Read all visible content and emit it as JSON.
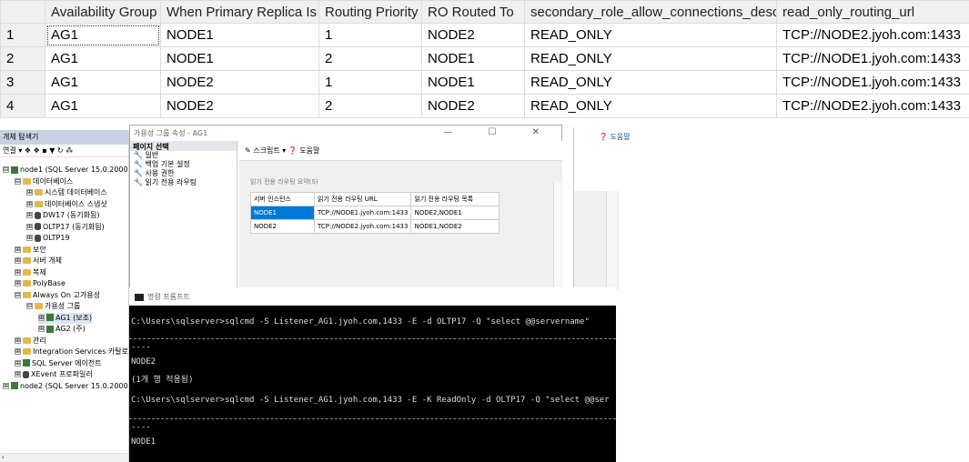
{
  "results": {
    "columns": [
      "",
      "Availability Group",
      "When Primary Replica Is",
      "Routing Priority",
      "RO Routed To",
      "secondary_role_allow_connections_desc",
      "read_only_routing_url"
    ],
    "rows": [
      [
        "1",
        "AG1",
        "NODE1",
        "1",
        "NODE2",
        "READ_ONLY",
        "TCP://NODE2.jyoh.com:1433"
      ],
      [
        "2",
        "AG1",
        "NODE1",
        "2",
        "NODE1",
        "READ_ONLY",
        "TCP://NODE1.jyoh.com:1433"
      ],
      [
        "3",
        "AG1",
        "NODE2",
        "1",
        "NODE1",
        "READ_ONLY",
        "TCP://NODE1.jyoh.com:1433"
      ],
      [
        "4",
        "AG1",
        "NODE2",
        "2",
        "NODE2",
        "READ_ONLY",
        "TCP://NODE2.jyoh.com:1433"
      ]
    ]
  },
  "object_explorer": {
    "title": "개체 탐색기",
    "toolbar": "연결 ▾ ❖ ❖ ▪ ▼ ↻ ⁂",
    "nodes": [
      {
        "label": "node1 (SQL Server 15.0.2000.",
        "level": 0,
        "expand": "⊟",
        "icon": "server-icon"
      },
      {
        "label": "데이터베이스",
        "level": 1,
        "expand": "⊟",
        "icon": "folder-icon"
      },
      {
        "label": "시스템 데이터베이스",
        "level": 2,
        "expand": "⊞",
        "icon": "folder-icon"
      },
      {
        "label": "데이터베이스 스냅샷",
        "level": 2,
        "expand": "⊞",
        "icon": "folder-icon"
      },
      {
        "label": "DW17 (동기화됨)",
        "level": 2,
        "expand": "⊞",
        "icon": "database-icon"
      },
      {
        "label": "OLTP17 (동기화됨)",
        "level": 2,
        "expand": "⊞",
        "icon": "database-icon"
      },
      {
        "label": "OLTP19",
        "level": 2,
        "expand": "⊞",
        "icon": "database-icon"
      },
      {
        "label": "보안",
        "level": 1,
        "expand": "⊞",
        "icon": "folder-icon"
      },
      {
        "label": "서버 개체",
        "level": 1,
        "expand": "⊞",
        "icon": "folder-icon"
      },
      {
        "label": "복제",
        "level": 1,
        "expand": "⊞",
        "icon": "folder-icon"
      },
      {
        "label": "PolyBase",
        "level": 1,
        "expand": "⊞",
        "icon": "folder-icon"
      },
      {
        "label": "Always On 고가용성",
        "level": 1,
        "expand": "⊟",
        "icon": "folder-icon"
      },
      {
        "label": "가용성 그룹",
        "level": 2,
        "expand": "⊟",
        "icon": "folder-icon"
      },
      {
        "label": "AG1 (보조)",
        "level": 3,
        "expand": "⊞",
        "icon": "availability-group-icon",
        "selected": true
      },
      {
        "label": "AG2 (주)",
        "level": 3,
        "expand": "⊞",
        "icon": "availability-group-icon"
      },
      {
        "label": "관리",
        "level": 1,
        "expand": "⊞",
        "icon": "folder-icon"
      },
      {
        "label": "Integration Services 카탈로",
        "level": 1,
        "expand": "⊞",
        "icon": "folder-icon"
      },
      {
        "label": "SQL Server 에이전트",
        "level": 1,
        "expand": "⊞",
        "icon": "agent-icon"
      },
      {
        "label": "XEvent 프로파일러",
        "level": 1,
        "expand": "⊞",
        "icon": "xevent-icon"
      },
      {
        "label": "node2 (SQL Server 15.0.2000.",
        "level": 0,
        "expand": "⊞",
        "icon": "server-icon"
      }
    ],
    "scroll_left": "‹"
  },
  "dialog": {
    "title": "가용성 그룹 속성 - AG1",
    "controls": "— ☐ ✕",
    "page_select": "페이지 선택",
    "pages": [
      "일반",
      "백업 기본 설정",
      "사용 권한",
      "읽기 전용 라우팅"
    ],
    "toolbar_script": "스크립트 ▾",
    "toolbar_help": "도움말",
    "routing_label": "읽기 전용 라우팅 요약(S)",
    "routing_columns": [
      "서버 인스턴스",
      "읽기 전용 라우팅 URL",
      "읽기 전용 라우팅 목록"
    ],
    "routing_rows": [
      [
        "NODE1",
        "TCP://NODE1.jyoh.com:1433",
        "NODE2,NODE1"
      ],
      [
        "NODE2",
        "TCP://NODE2.jyoh.com:1433",
        "NODE1,NODE2"
      ]
    ]
  },
  "help_panel": {
    "button": "도움말"
  },
  "cmd": {
    "title": "명령 프롬프트",
    "line1": "C:\\Users\\sqlserver>sqlcmd -S Listener_AG1.jyoh.com,1433 -E -d OLTP17 -Q \"select @@servername\"",
    "line2": "----",
    "line3": "NODE2",
    "line4": "(1개 행 적용됨)",
    "line5": "C:\\Users\\sqlserver>sqlcmd -S Listener_AG1.jyoh.com,1433 -E -K ReadOnly -d OLTP17 -Q \"select @@ser",
    "line6": "----",
    "line7": "NODE1"
  }
}
